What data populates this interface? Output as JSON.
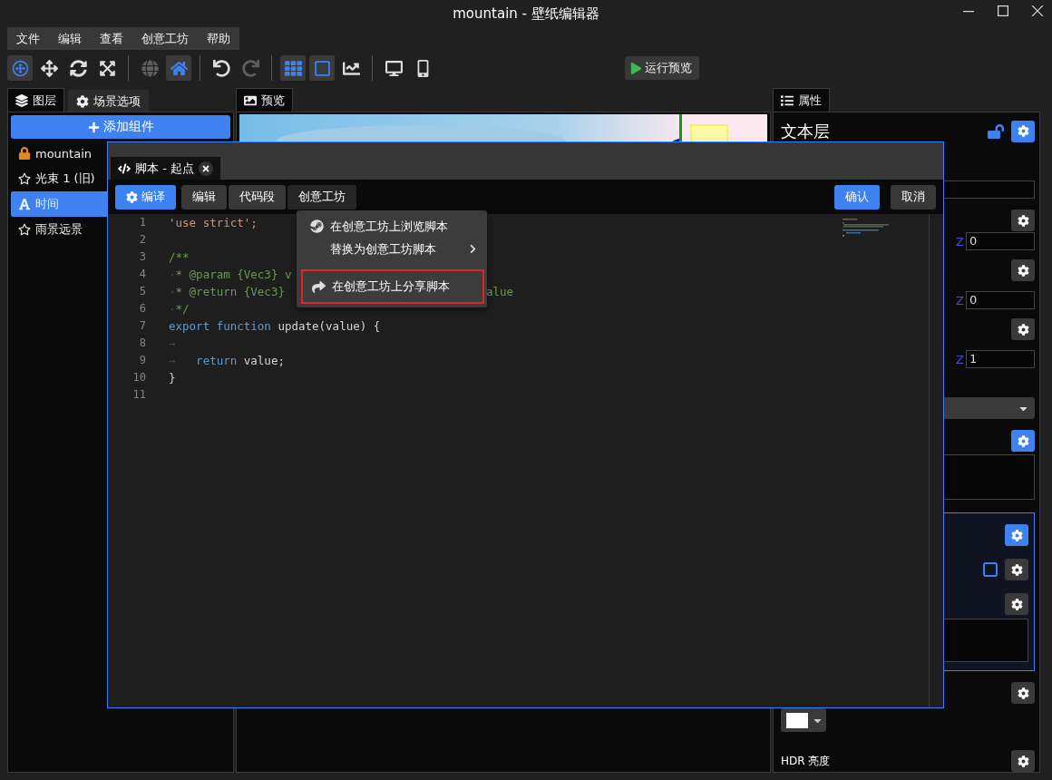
{
  "window": {
    "title": "mountain - 壁纸编辑器"
  },
  "menubar": [
    "文件",
    "编辑",
    "查看",
    "创意工坊",
    "帮助"
  ],
  "toolbar": {
    "groups": [
      [
        {
          "kind": "gizmo",
          "selected": true,
          "disabled": false
        },
        {
          "kind": "move",
          "selected": false,
          "disabled": false
        },
        {
          "kind": "rotate",
          "selected": false,
          "disabled": false
        },
        {
          "kind": "scale",
          "selected": false,
          "disabled": false
        }
      ],
      [
        {
          "kind": "globe",
          "selected": false,
          "disabled": true
        },
        {
          "kind": "home",
          "selected": true,
          "disabled": false
        }
      ],
      [
        {
          "kind": "undo",
          "selected": false,
          "disabled": false
        },
        {
          "kind": "redo",
          "selected": false,
          "disabled": true
        }
      ],
      [
        {
          "kind": "grid",
          "selected": true,
          "disabled": false
        },
        {
          "kind": "frame",
          "selected": true,
          "disabled": false
        },
        {
          "kind": "graph",
          "selected": false,
          "disabled": false
        }
      ],
      [
        {
          "kind": "desktop",
          "selected": false,
          "disabled": false
        },
        {
          "kind": "phone",
          "selected": false,
          "disabled": false
        }
      ]
    ],
    "run_button": "运行预览"
  },
  "left_panel": {
    "tabs": [
      {
        "label": "图层",
        "kind": "layers",
        "selected": true
      },
      {
        "label": "场景选项",
        "kind": "settings",
        "selected": false
      }
    ],
    "add_button": "添加组件",
    "layers": [
      {
        "label": "mountain",
        "kind": "lock",
        "selected": false
      },
      {
        "label": "光束 1 (旧)",
        "kind": "star",
        "selected": false
      },
      {
        "label": "时间",
        "kind": "text",
        "selected": true
      },
      {
        "label": "雨景远景",
        "kind": "star",
        "selected": false
      }
    ]
  },
  "preview": {
    "tab": "预览"
  },
  "properties": {
    "tab": "属性",
    "title": "文本层",
    "z_fields": [
      {
        "label": "Z",
        "value": "0"
      },
      {
        "label": "Z",
        "value": "0"
      },
      {
        "label": "Z",
        "value": "1"
      }
    ],
    "checkbox": {
      "checked": false
    },
    "hdr_label": "HDR 亮度"
  },
  "dialog": {
    "tab": "脚本 - 起点",
    "buttons": [
      {
        "label": "编译",
        "kind": "primary"
      },
      {
        "label": "编辑",
        "kind": "plain"
      },
      {
        "label": "代码段",
        "kind": "plain"
      },
      {
        "label": "创意工坊",
        "kind": "open"
      }
    ],
    "confirm": "确认",
    "cancel": "取消",
    "lines": [
      {
        "number": "1",
        "segments": [
          {
            "text": "'use strict';",
            "kind": "string"
          }
        ]
      },
      {
        "number": "2"
      },
      {
        "number": "3",
        "segments": [
          {
            "text": "/**",
            "kind": "comment"
          }
        ]
      },
      {
        "number": "4",
        "segments": [
          {
            "text": "·",
            "kind": "space"
          },
          {
            "text": "* @param {Vec3} v",
            "kind": "comment"
          }
        ]
      },
      {
        "number": "5",
        "segments": [
          {
            "text": "·",
            "kind": "space"
          },
          {
            "text": "* @return {Vec3}",
            "kind": "comment"
          },
          {
            "text": "alue",
            "kind": "tail"
          }
        ]
      },
      {
        "number": "6",
        "segments": [
          {
            "text": "·",
            "kind": "space"
          },
          {
            "text": "*/",
            "kind": "comment"
          }
        ]
      },
      {
        "number": "7",
        "segments": [
          {
            "text": "export function",
            "kind": "keyword"
          },
          {
            "text": " update(value) {",
            "kind": "plain"
          }
        ]
      },
      {
        "number": "8",
        "segments": [
          {
            "text": "→",
            "kind": "space"
          }
        ]
      },
      {
        "number": "9",
        "segments": [
          {
            "text": "→",
            "kind": "space"
          },
          {
            "text": "   return",
            "kind": "keyword"
          },
          {
            "text": " value;",
            "kind": "plain"
          }
        ]
      },
      {
        "number": "10",
        "segments": [
          {
            "text": "}",
            "kind": "plain"
          }
        ]
      },
      {
        "number": "11"
      }
    ]
  },
  "menu": {
    "items": [
      {
        "label": "在创意工坊上浏览脚本",
        "kind": "browse",
        "submenu": false,
        "highlighted": false
      },
      {
        "label": "替换为创意工坊脚本",
        "kind": "replace",
        "submenu": true,
        "highlighted": false
      },
      {
        "label": "在创意工坊上分享脚本",
        "kind": "share",
        "submenu": false,
        "highlighted": true
      }
    ]
  }
}
